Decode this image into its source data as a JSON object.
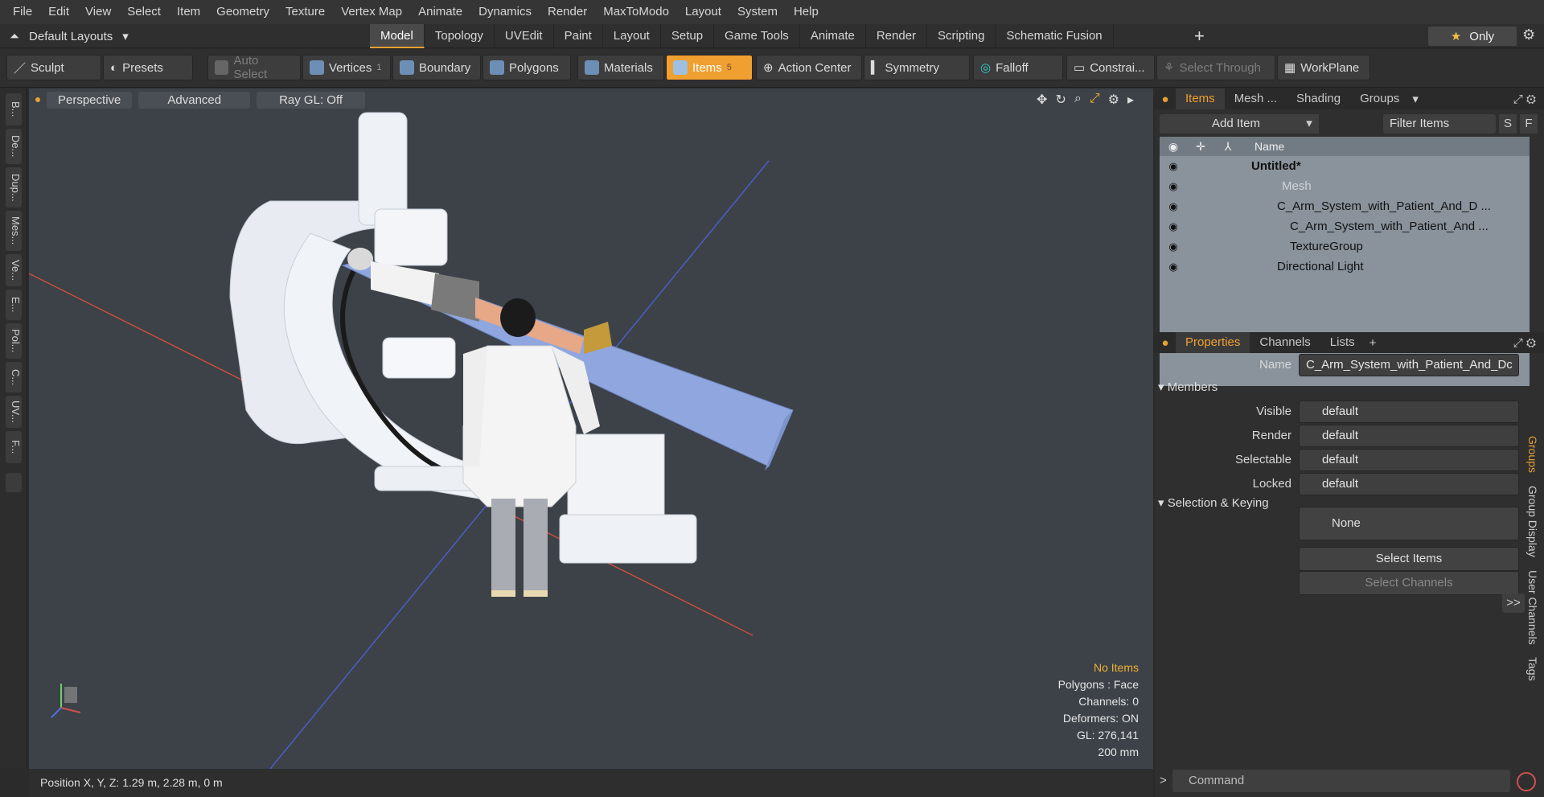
{
  "menu": [
    "File",
    "Edit",
    "View",
    "Select",
    "Item",
    "Geometry",
    "Texture",
    "Vertex Map",
    "Animate",
    "Dynamics",
    "Render",
    "MaxToModo",
    "Layout",
    "System",
    "Help"
  ],
  "layout_dropdown": "Default Layouts",
  "tabs": [
    "Model",
    "Topology",
    "UVEdit",
    "Paint",
    "Layout",
    "Setup",
    "Game Tools",
    "Animate",
    "Render",
    "Scripting",
    "Schematic Fusion"
  ],
  "only_label": "Only",
  "toolbar": {
    "sculpt": "Sculpt",
    "presets": "Presets",
    "auto_select": "Auto Select",
    "vertices": "Vertices",
    "vertices_count": "1",
    "boundary": "Boundary",
    "polygons": "Polygons",
    "materials": "Materials",
    "items": "Items",
    "items_count": "5",
    "action_center": "Action Center",
    "symmetry": "Symmetry",
    "falloff": "Falloff",
    "constraints": "Constrai...",
    "select_through": "Select Through",
    "workplane": "WorkPlane"
  },
  "left_tabs": [
    "B...",
    "De...",
    "Dup...",
    "Mes...",
    "Ve...",
    "E...",
    "Pol...",
    "C...",
    "UV...",
    "F..."
  ],
  "viewport": {
    "perspective": "Perspective",
    "advanced": "Advanced",
    "raygl": "Ray GL: Off",
    "hud": {
      "no_items": "No Items",
      "polygons": "Polygons : Face",
      "channels": "Channels: 0",
      "deformers": "Deformers: ON",
      "gl": "GL: 276,141",
      "scale": "200 mm"
    }
  },
  "status": "Position X, Y, Z:   1.29 m, 2.28 m, 0 m",
  "items_panel": {
    "tabs": [
      "Items",
      "Mesh ...",
      "Shading",
      "Groups"
    ],
    "add_item": "Add Item",
    "filter": "Filter Items",
    "s": "S",
    "f": "F",
    "name_col": "Name",
    "rows": [
      "Untitled*",
      "Mesh",
      "C_Arm_System_with_Patient_And_D ...",
      "C_Arm_System_with_Patient_And ...",
      "TextureGroup",
      "Directional Light"
    ]
  },
  "props_panel": {
    "tabs": [
      "Properties",
      "Channels",
      "Lists"
    ],
    "name_label": "Name",
    "name_value": "C_Arm_System_with_Patient_And_Dc",
    "members": "Members",
    "fields": [
      {
        "label": "Visible",
        "value": "default"
      },
      {
        "label": "Render",
        "value": "default"
      },
      {
        "label": "Selectable",
        "value": "default"
      },
      {
        "label": "Locked",
        "value": "default"
      }
    ],
    "sel_keying": "Selection & Keying",
    "none": "None",
    "select_items": "Select Items",
    "select_channels": "Select Channels",
    "more": ">>"
  },
  "right_vtabs": [
    "Groups",
    "Group Display",
    "User Channels",
    "Tags"
  ],
  "command": "Command"
}
